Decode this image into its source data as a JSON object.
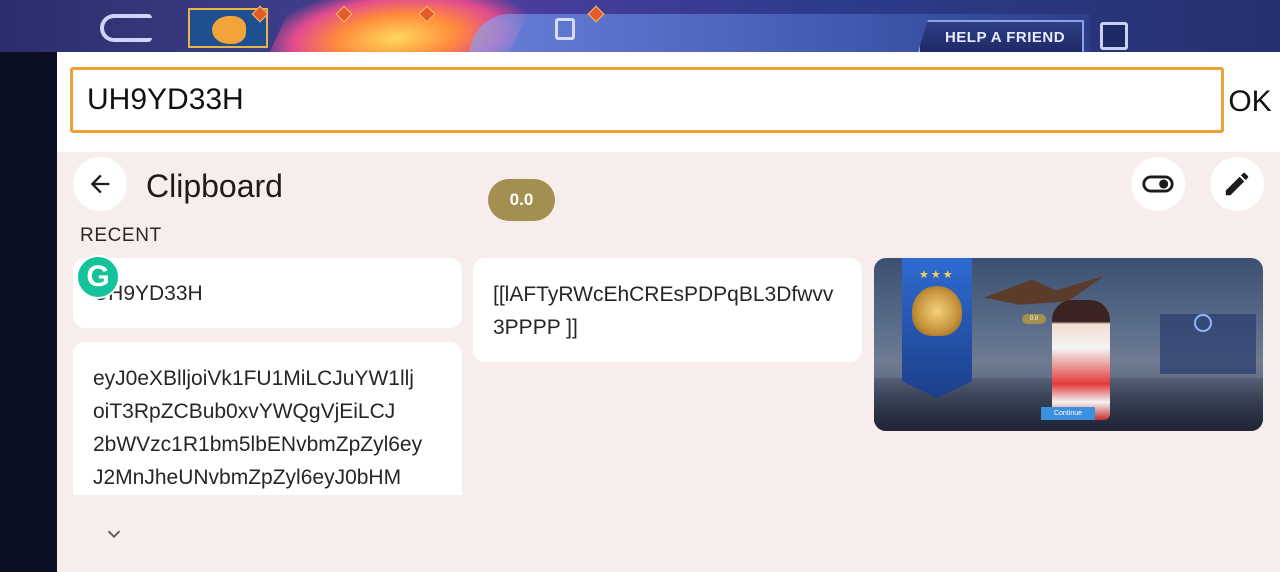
{
  "game": {
    "help_friend_label": "HELP A FRIEND"
  },
  "input": {
    "value": "UH9YD33H",
    "ok_label": "OK"
  },
  "clipboard": {
    "title": "Clipboard",
    "recent_label": "RECENT",
    "pill_label": "0.0",
    "items": [
      {
        "type": "text",
        "text": "UH9YD33H"
      },
      {
        "type": "text",
        "text": "[[lAFTyRWcEhCREsPDPqBL3Dfwvv3PPPP ]]",
        "lines": [
          "[[lAFTyRWcEhCREsPDPqBL3Dfwvv",
          "3PPPP ]]"
        ]
      },
      {
        "type": "text",
        "lines": [
          "eyJ0eXBlljoiVk1FU1MiLCJuYW1llj",
          "oiT3RpZCBub0xvYWQgVjEiLCJ",
          "2bWVzc1R1bm5lbENvbmZpZyl6ey",
          "J2MnJheUNvbmZpZyl6eyJ0bHM"
        ]
      },
      {
        "type": "image",
        "description": "game-screenshot",
        "chip_label": "0.0",
        "continue_label": "Continue"
      }
    ]
  },
  "icons": {
    "back": "arrow-left-icon",
    "toggle": "toggle-icon",
    "edit": "pencil-icon",
    "expand": "chevron-down-icon",
    "grammarly": "grammarly-icon"
  },
  "colors": {
    "input_border": "#f0a036",
    "panel_bg": "#f8eded",
    "pill_bg": "#a39050",
    "card_bg": "#ffffff",
    "grammarly": "#15c39a"
  }
}
